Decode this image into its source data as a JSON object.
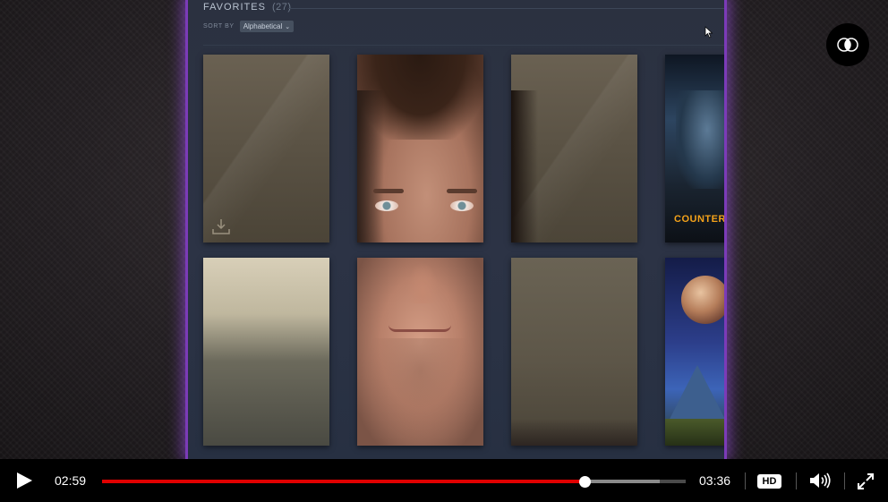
{
  "favorites": {
    "title": "FAVORITES",
    "count": "(27)",
    "sort_label": "SORT BY",
    "sort_value": "Alphabetical"
  },
  "tiles": [
    {
      "name": "tile-wall-1",
      "icon": "download-icon"
    },
    {
      "name": "tile-face-eyes"
    },
    {
      "name": "tile-wall-2"
    },
    {
      "name": "tile-counter-strike",
      "text": "COUNTER"
    },
    {
      "name": "tile-window-blur"
    },
    {
      "name": "tile-face-mouth"
    },
    {
      "name": "tile-wall-3"
    },
    {
      "name": "tile-planet-landscape"
    }
  ],
  "player": {
    "current_time": "02:59",
    "total_time": "03:36",
    "progress": 0.827,
    "buffered": 0.955,
    "hd_label": "HD",
    "colors": {
      "played": "#e00000",
      "accent_border": "#7b3bb8"
    }
  },
  "icons": {
    "play": "play-icon",
    "volume": "volume-icon",
    "fullscreen": "fullscreen-icon",
    "overlay": "overlay-toggle-icon",
    "cursor": "mouse-cursor-icon"
  }
}
